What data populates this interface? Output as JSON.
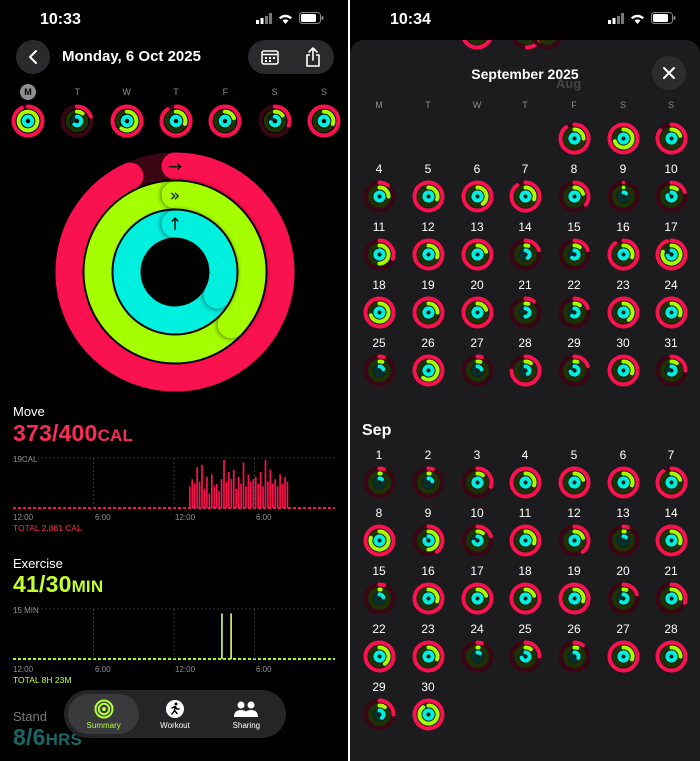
{
  "left": {
    "status_time": "10:33",
    "date_title": "Monday, 6 Oct 2025",
    "week": [
      {
        "label": "M",
        "selected": true,
        "move": 0.93,
        "exercise": 1.0,
        "stand": 1.0
      },
      {
        "label": "T",
        "selected": false,
        "move": 0.2,
        "exercise": 0.1,
        "stand": 0.6
      },
      {
        "label": "W",
        "selected": false,
        "move": 1.0,
        "exercise": 0.6,
        "stand": 1.0
      },
      {
        "label": "T",
        "selected": false,
        "move": 0.9,
        "exercise": 0.3,
        "stand": 1.0
      },
      {
        "label": "F",
        "selected": false,
        "move": 1.0,
        "exercise": 0.2,
        "stand": 1.0
      },
      {
        "label": "S",
        "selected": false,
        "move": 0.3,
        "exercise": 0.15,
        "stand": 0.7
      },
      {
        "label": "S",
        "selected": false,
        "move": 1.0,
        "exercise": 0.3,
        "stand": 1.0
      }
    ],
    "move": {
      "title": "Move",
      "value": "373/400",
      "unit": "CAL",
      "max_label": "19CAL",
      "total": "TOTAL 2,881 CAL",
      "bars": [
        0,
        0,
        0,
        0,
        0,
        0,
        0,
        0,
        0,
        0,
        0,
        0,
        0,
        0,
        0,
        0,
        0,
        0,
        0,
        0,
        0,
        0,
        0,
        0,
        0,
        0,
        0,
        0,
        0,
        0,
        0,
        0,
        0,
        0,
        0,
        0,
        0,
        0,
        0,
        0,
        0,
        0,
        0,
        0,
        0,
        0,
        0,
        0,
        0,
        0,
        0,
        0,
        0,
        0,
        0,
        0,
        0,
        0,
        0,
        0,
        0,
        0,
        0,
        0,
        0,
        0,
        0,
        0,
        0,
        0,
        0,
        0,
        0.45,
        0.6,
        0.5,
        0.85,
        0.55,
        0.9,
        0.4,
        0.65,
        0.3,
        0.7,
        0.45,
        0.5,
        0.35,
        0.6,
        1.0,
        0.55,
        0.75,
        0.6,
        0.8,
        0.4,
        0.65,
        0.5,
        0.95,
        0.45,
        0.7,
        0.55,
        0.6,
        0.65,
        0.5,
        0.75,
        0.45,
        1.0,
        0.55,
        0.8,
        0.5,
        0.6,
        0.45,
        0.7,
        0.5,
        0.65,
        0.55,
        0,
        0,
        0,
        0,
        0,
        0,
        0,
        0,
        0,
        0,
        0,
        0,
        0,
        0,
        0,
        0,
        0,
        0,
        0
      ]
    },
    "exercise": {
      "title": "Exercise",
      "value": "41/30",
      "unit": "MIN",
      "max_label": "15 MIN",
      "total": "TOTAL 8H 23M",
      "bars": [
        0,
        0,
        0,
        0,
        0,
        0,
        0,
        0,
        0,
        0,
        0,
        0,
        0,
        0,
        0,
        0,
        0,
        0,
        0,
        0,
        0,
        0,
        0,
        0,
        0,
        0,
        0,
        0,
        0,
        0,
        0,
        0,
        0,
        0,
        0,
        0,
        0,
        0,
        0,
        0,
        0,
        0,
        0,
        0,
        0,
        0,
        0,
        0,
        0,
        0,
        0,
        0,
        0,
        0,
        0,
        0,
        0,
        0,
        0,
        0,
        0,
        0,
        0,
        0,
        0,
        0,
        0,
        0,
        0,
        0,
        0,
        0,
        0,
        0,
        0,
        0,
        0,
        0,
        0,
        0,
        0,
        0,
        0,
        0,
        0,
        0,
        0,
        0,
        0,
        0,
        0.0,
        0.95,
        0,
        0,
        0,
        0.95,
        0,
        0,
        0,
        0,
        0,
        0,
        0,
        0,
        0,
        0,
        0,
        0,
        0,
        0,
        0,
        0,
        0,
        0,
        0,
        0,
        0,
        0,
        0,
        0,
        0,
        0,
        0,
        0,
        0,
        0,
        0,
        0,
        0,
        0,
        0,
        0,
        0,
        0,
        0,
        0,
        0,
        0,
        0,
        0,
        0
      ]
    },
    "x_ticks": [
      "12:00",
      "6:00",
      "12:00",
      "6:00"
    ],
    "stand": {
      "title": "Stand",
      "value": "8/6",
      "unit": "HRS"
    },
    "tabs": [
      {
        "label": "Summary",
        "active": true
      },
      {
        "label": "Workout",
        "active": false
      },
      {
        "label": "Sharing",
        "active": false
      }
    ],
    "ring": {
      "move": 0.93,
      "exercise": 1.37,
      "stand": 1.33
    }
  },
  "right": {
    "status_time": "10:34",
    "title": "September 2025",
    "peek_label": "Aug",
    "dow": [
      "M",
      "T",
      "W",
      "T",
      "F",
      "S",
      "S"
    ],
    "month1": {
      "start_col": 4,
      "days": [
        {
          "d": "",
          "m": 0.9,
          "e": 0.25,
          "s": 1.0
        },
        {
          "d": "",
          "m": 1.0,
          "e": 0.7,
          "s": 1.0
        },
        {
          "d": "",
          "m": 0.85,
          "e": 0.2,
          "s": 1.0
        },
        {
          "d": "4",
          "m": 0.1,
          "e": 0.25,
          "s": 0.9
        },
        {
          "d": "5",
          "m": 1.0,
          "e": 0.3,
          "s": 1.0
        },
        {
          "d": "6",
          "m": 1.0,
          "e": 0.4,
          "s": 1.0
        },
        {
          "d": "7",
          "m": 0.9,
          "e": 0.3,
          "s": 1.0
        },
        {
          "d": "8",
          "m": 0.35,
          "e": 0.2,
          "s": 1.0
        },
        {
          "d": "9",
          "m": 0.0,
          "e": 0.0,
          "s": 0.1
        },
        {
          "d": "10",
          "m": 0.2,
          "e": 0.1,
          "s": 0.8
        },
        {
          "d": "11",
          "m": 0.3,
          "e": 0.5,
          "s": 0.9
        },
        {
          "d": "12",
          "m": 1.0,
          "e": 0.3,
          "s": 1.0
        },
        {
          "d": "13",
          "m": 1.0,
          "e": 0.2,
          "s": 1.0
        },
        {
          "d": "14",
          "m": 0.2,
          "e": 0.05,
          "s": 0.4
        },
        {
          "d": "15",
          "m": 0.2,
          "e": 0.1,
          "s": 0.6
        },
        {
          "d": "16",
          "m": 0.9,
          "e": 0.3,
          "s": 1.0
        },
        {
          "d": "17",
          "m": 0.95,
          "e": 0.8,
          "s": 0.7
        },
        {
          "d": "18",
          "m": 1.0,
          "e": 0.7,
          "s": 1.0
        },
        {
          "d": "19",
          "m": 1.0,
          "e": 0.25,
          "s": 1.0
        },
        {
          "d": "20",
          "m": 1.0,
          "e": 0.2,
          "s": 1.0
        },
        {
          "d": "21",
          "m": 0.1,
          "e": 0.05,
          "s": 0.5
        },
        {
          "d": "22",
          "m": 0.2,
          "e": 0.1,
          "s": 0.6
        },
        {
          "d": "23",
          "m": 1.0,
          "e": 0.4,
          "s": 1.0
        },
        {
          "d": "24",
          "m": 1.0,
          "e": 0.3,
          "s": 1.0
        },
        {
          "d": "25",
          "m": 0.05,
          "e": 0.05,
          "s": 0.2
        },
        {
          "d": "26",
          "m": 1.0,
          "e": 0.6,
          "s": 1.0
        },
        {
          "d": "27",
          "m": 0.05,
          "e": 0.05,
          "s": 0.2
        },
        {
          "d": "28",
          "m": 0.75,
          "e": 0.1,
          "s": 0.4
        },
        {
          "d": "29",
          "m": 0.2,
          "e": 0.05,
          "s": 0.7
        },
        {
          "d": "30",
          "m": 1.0,
          "e": 0.3,
          "s": 1.0
        },
        {
          "d": "31",
          "m": 0.25,
          "e": 0.1,
          "s": 0.6
        }
      ]
    },
    "month2_label": "Sep",
    "month2": {
      "start_col": 0,
      "days": [
        {
          "d": "1",
          "m": 0.05,
          "e": 0.02,
          "s": 0.1
        },
        {
          "d": "2",
          "m": 0.05,
          "e": 0.02,
          "s": 0.2
        },
        {
          "d": "3",
          "m": 0.3,
          "e": 0.1,
          "s": 0.9
        },
        {
          "d": "4",
          "m": 1.0,
          "e": 0.3,
          "s": 1.0
        },
        {
          "d": "5",
          "m": 1.0,
          "e": 0.2,
          "s": 1.0
        },
        {
          "d": "6",
          "m": 1.0,
          "e": 0.3,
          "s": 1.0
        },
        {
          "d": "7",
          "m": 0.9,
          "e": 0.2,
          "s": 1.0
        },
        {
          "d": "8",
          "m": 1.0,
          "e": 0.8,
          "s": 1.0
        },
        {
          "d": "9",
          "m": 0.4,
          "e": 0.5,
          "s": 0.8
        },
        {
          "d": "10",
          "m": 0.2,
          "e": 0.1,
          "s": 0.7
        },
        {
          "d": "11",
          "m": 1.0,
          "e": 0.3,
          "s": 1.0
        },
        {
          "d": "12",
          "m": 0.4,
          "e": 0.2,
          "s": 0.9
        },
        {
          "d": "13",
          "m": 0.05,
          "e": 0.02,
          "s": 0.1
        },
        {
          "d": "14",
          "m": 1.0,
          "e": 0.3,
          "s": 1.0
        },
        {
          "d": "15",
          "m": 0.05,
          "e": 0.02,
          "s": 0.2
        },
        {
          "d": "16",
          "m": 1.0,
          "e": 0.3,
          "s": 1.0
        },
        {
          "d": "17",
          "m": 1.0,
          "e": 0.2,
          "s": 1.0
        },
        {
          "d": "18",
          "m": 1.0,
          "e": 0.2,
          "s": 1.0
        },
        {
          "d": "19",
          "m": 1.0,
          "e": 0.3,
          "s": 1.0
        },
        {
          "d": "20",
          "m": 0.2,
          "e": 0.05,
          "s": 0.6
        },
        {
          "d": "21",
          "m": 0.3,
          "e": 0.25,
          "s": 0.9
        },
        {
          "d": "22",
          "m": 1.0,
          "e": 0.4,
          "s": 1.0
        },
        {
          "d": "23",
          "m": 1.0,
          "e": 0.3,
          "s": 1.0
        },
        {
          "d": "24",
          "m": 0.05,
          "e": 0.02,
          "s": 0.1
        },
        {
          "d": "25",
          "m": 0.25,
          "e": 0.1,
          "s": 0.7
        },
        {
          "d": "26",
          "m": 0.1,
          "e": 0.05,
          "s": 0.3
        },
        {
          "d": "27",
          "m": 1.0,
          "e": 0.3,
          "s": 1.0
        },
        {
          "d": "28",
          "m": 1.0,
          "e": 0.25,
          "s": 1.0
        },
        {
          "d": "29",
          "m": 0.25,
          "e": 0.1,
          "s": 0.4
        },
        {
          "d": "30",
          "m": 1.0,
          "e": 0.9,
          "s": 1.0
        }
      ]
    }
  },
  "colors": {
    "move": "#fa114f",
    "move_bg": "#3a0614",
    "exercise": "#a6ff00",
    "exercise_bg": "#1f3300",
    "stand": "#00f0e0",
    "stand_bg": "#003330",
    "move_text": "#fa2d55",
    "exercise_text": "#c3ff2e",
    "stand_text": "#3be0e0"
  }
}
